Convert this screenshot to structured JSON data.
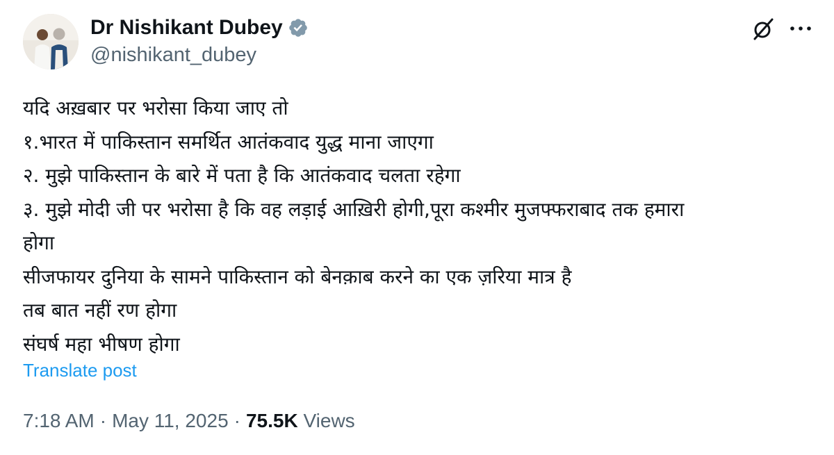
{
  "author": {
    "display_name": "Dr Nishikant Dubey",
    "handle": "@nishikant_dubey",
    "verified_color": "#829aab"
  },
  "header_icons": {
    "grok": "grok-icon",
    "more": "more-icon"
  },
  "post": {
    "lines": [
      "यदि अख़बार पर भरोसा किया जाए तो",
      "१.भारत में पाकिस्तान समर्थित आतंकवाद युद्ध माना जाएगा",
      "२. मुझे पाकिस्तान के बारे में पता है कि आतंकवाद चलता रहेगा",
      "३. मुझे मोदी जी पर भरोसा है कि वह लड़ाई आख़िरी होगी,पूरा कश्मीर मुजफ्फराबाद तक हमारा",
      "होगा",
      "सीजफायर दुनिया के सामने पाकिस्तान को बेनक़ाब करने का एक ज़रिया मात्र है",
      "तब बात नहीं रण होगा",
      "संघर्ष महा भीषण होगा"
    ],
    "translate_label": "Translate post"
  },
  "meta": {
    "time": "7:18 AM",
    "separator": "·",
    "date": "May 11, 2025",
    "views_count": "75.5K",
    "views_label": "Views"
  },
  "colors": {
    "text": "#0f1419",
    "secondary": "#536471",
    "link": "#1d9bf0"
  }
}
